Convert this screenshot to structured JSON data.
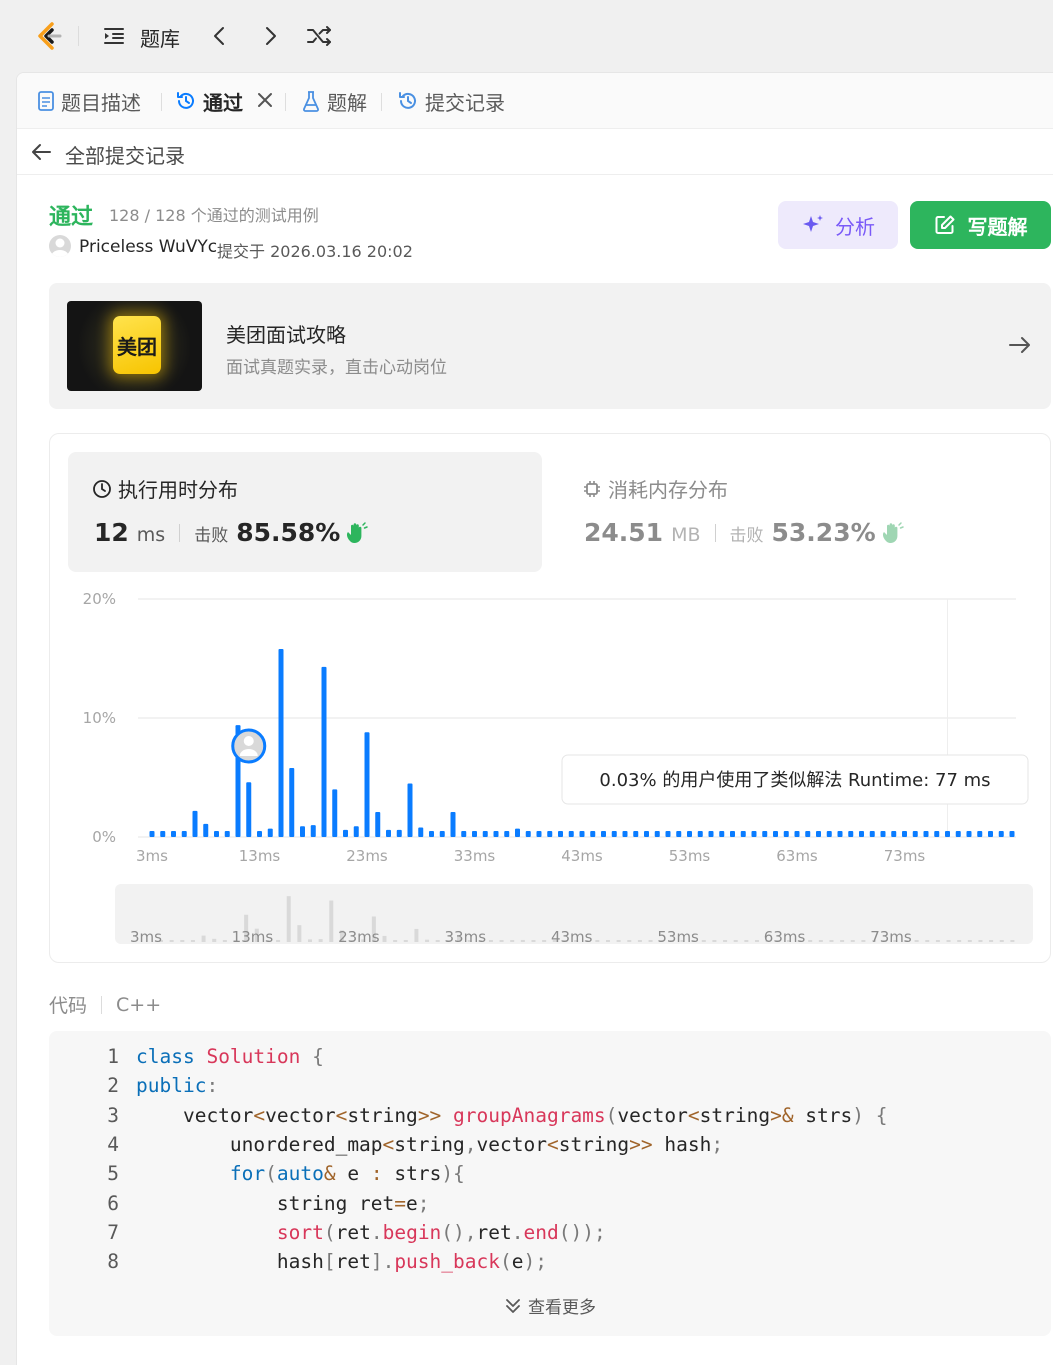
{
  "nav": {
    "title": "题库",
    "logo_icon": "leetcode-logo-icon",
    "icons": [
      "list-indent-icon",
      "chevron-left-icon",
      "chevron-right-icon",
      "shuffle-icon"
    ]
  },
  "tabs": [
    {
      "label": "题目描述",
      "icon": "document-icon"
    },
    {
      "label": "通过",
      "icon": "history-icon",
      "active": true
    },
    {
      "label": "题解",
      "icon": "flask-icon"
    },
    {
      "label": "提交记录",
      "icon": "history-icon"
    }
  ],
  "back": {
    "label": "全部提交记录"
  },
  "result": {
    "status": "通过",
    "testcases": "128 / 128 个通过的测试用例",
    "username": "Priceless WuVYc",
    "submitted": "提交于 2026.03.16 20:02"
  },
  "actions": {
    "analyze": "分析",
    "write_solution": "写题解"
  },
  "promo": {
    "badge_text": "美团",
    "title": "美团面试攻略",
    "subtitle": "面试真题实录，直击心动岗位"
  },
  "runtime": {
    "label": "执行用时分布",
    "value": "12",
    "unit": "ms",
    "beat_label": "击败",
    "beat_pct": "85.58%"
  },
  "memory": {
    "label": "消耗内存分布",
    "value": "24.51",
    "unit": "MB",
    "beat_label": "击败",
    "beat_pct": "53.23%"
  },
  "chart_data": {
    "type": "bar",
    "title": "",
    "xlabel": "",
    "ylabel": "",
    "yticks": [
      "20%",
      "10%",
      "0%"
    ],
    "ylim": [
      0,
      20
    ],
    "xticks": [
      "3ms",
      "13ms",
      "23ms",
      "33ms",
      "43ms",
      "53ms",
      "63ms",
      "73ms"
    ],
    "x": [
      3,
      4,
      5,
      6,
      7,
      8,
      9,
      10,
      11,
      12,
      13,
      14,
      15,
      16,
      17,
      18,
      19,
      20,
      21,
      22,
      23,
      24,
      25,
      26,
      27,
      28,
      29,
      30,
      31,
      32,
      33,
      34,
      35,
      36,
      37,
      38,
      39,
      40,
      41,
      42,
      43,
      44,
      45,
      46,
      47,
      48,
      49,
      50,
      51,
      52,
      53,
      54,
      55,
      56,
      57,
      58,
      59,
      60,
      61,
      62,
      63,
      64,
      65,
      66,
      67,
      68,
      69,
      70,
      71,
      72,
      73,
      74,
      75,
      76,
      77,
      78,
      79,
      80,
      81,
      82,
      83
    ],
    "values": [
      0.5,
      0.5,
      0.5,
      0.5,
      2.2,
      1.1,
      0.5,
      0.5,
      9.4,
      4.6,
      0.5,
      0.7,
      15.8,
      5.8,
      0.9,
      1.0,
      14.3,
      4.0,
      0.6,
      0.9,
      8.8,
      2.1,
      0.6,
      0.6,
      4.5,
      0.8,
      0.5,
      0.5,
      2.1,
      0.5,
      0.5,
      0.5,
      0.5,
      0.5,
      0.7,
      0.5,
      0.5,
      0.5,
      0.5,
      0.5,
      0.5,
      0.5,
      0.5,
      0.5,
      0.5,
      0.5,
      0.5,
      0.5,
      0.5,
      0.5,
      0.5,
      0.5,
      0.5,
      0.5,
      0.5,
      0.5,
      0.5,
      0.5,
      0.5,
      0.5,
      0.5,
      0.5,
      0.5,
      0.5,
      0.5,
      0.5,
      0.5,
      0.5,
      0.5,
      0.5,
      0.5,
      0.5,
      0.5,
      0.5,
      0.5,
      0.5,
      0.5,
      0.5,
      0.5,
      0.5,
      0.5
    ],
    "highlight_x": 12,
    "bar_color": "#0a7cff",
    "tooltip": "0.03% 的用户使用了类似解法 Runtime: 77 ms",
    "grid": true
  },
  "code": {
    "label": "代码",
    "language": "C++",
    "show_more": "查看更多",
    "lines": [
      "1",
      "2",
      "3",
      "4",
      "5",
      "6",
      "7",
      "8"
    ]
  },
  "colors": {
    "accent_green": "#2db55d",
    "accent_purple": "#7a5af8",
    "bar_blue": "#0a7cff"
  }
}
